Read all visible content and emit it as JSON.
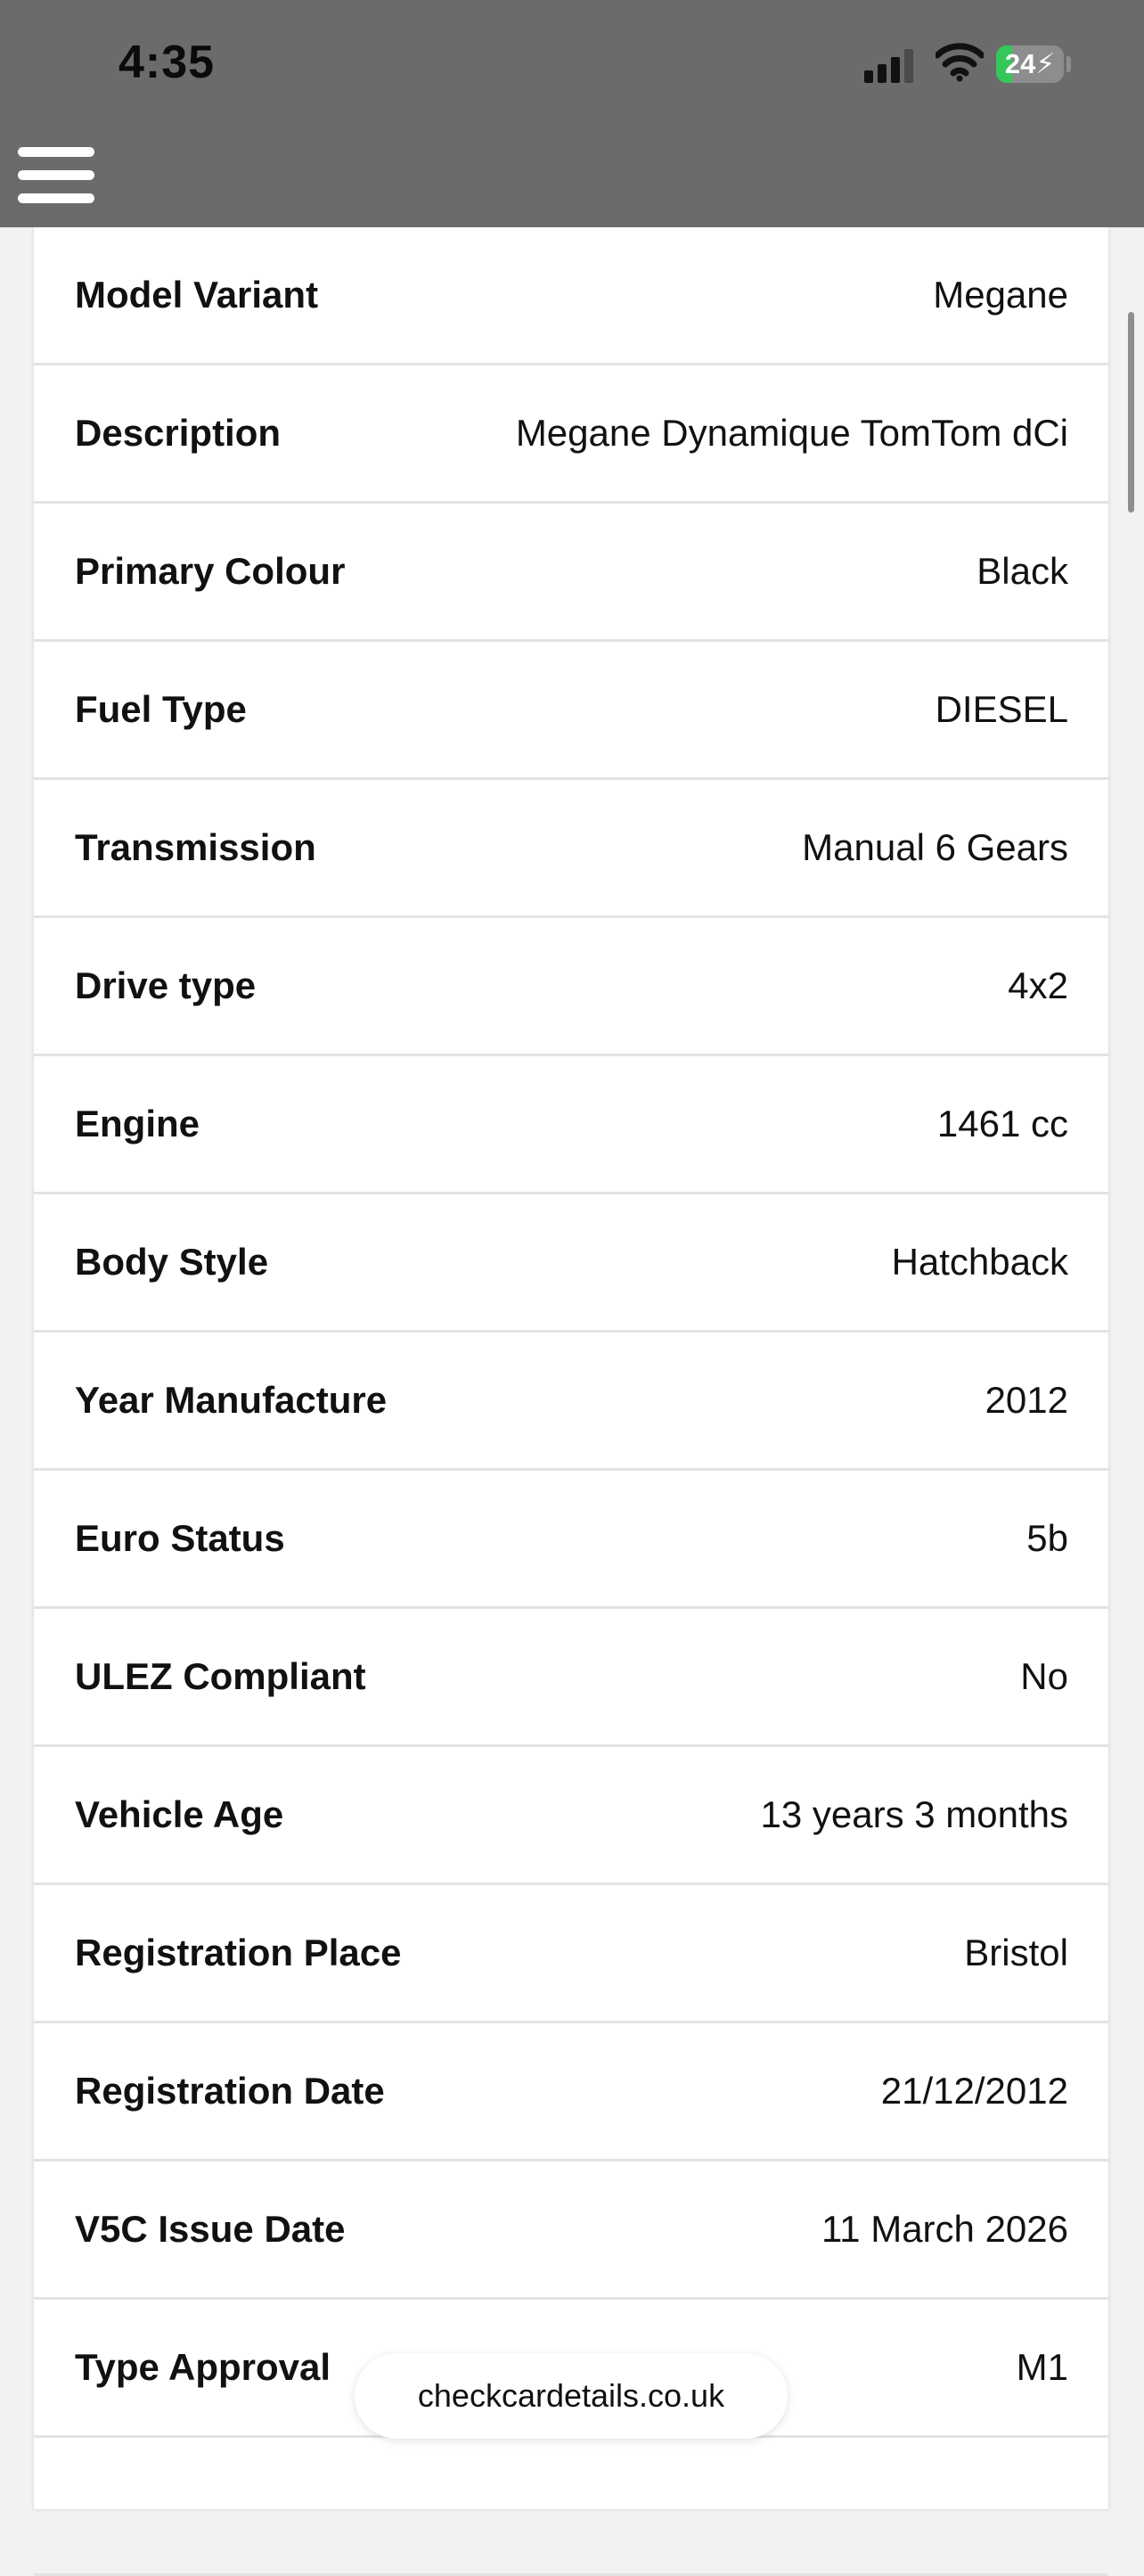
{
  "status_bar": {
    "time": "4:35",
    "battery_level": "24",
    "battery_fill_percent": 24,
    "battery_color": "#34c759",
    "icons": [
      "signal-icon",
      "wifi-icon",
      "battery-charging-icon"
    ]
  },
  "header": {
    "menu_icon": "hamburger-menu-icon",
    "background_color": "#6b6b6b"
  },
  "details": [
    {
      "label": "Model Variant",
      "value": "Megane"
    },
    {
      "label": "Description",
      "value": "Megane Dynamique TomTom dCi"
    },
    {
      "label": "Primary Colour",
      "value": "Black"
    },
    {
      "label": "Fuel Type",
      "value": "DIESEL"
    },
    {
      "label": "Transmission",
      "value": "Manual 6 Gears"
    },
    {
      "label": "Drive type",
      "value": "4x2"
    },
    {
      "label": "Engine",
      "value": "1461 cc"
    },
    {
      "label": "Body Style",
      "value": "Hatchback"
    },
    {
      "label": "Year Manufacture",
      "value": "2012"
    },
    {
      "label": "Euro Status",
      "value": "5b"
    },
    {
      "label": "ULEZ Compliant",
      "value": "No"
    },
    {
      "label": "Vehicle Age",
      "value": "13 years 3 months"
    },
    {
      "label": "Registration Place",
      "value": "Bristol"
    },
    {
      "label": "Registration Date",
      "value": "21/12/2012"
    },
    {
      "label": "V5C Issue Date",
      "value": "11 March 2026"
    },
    {
      "label": "Type Approval",
      "value": "M1"
    },
    {
      "label": "",
      "value": ""
    }
  ],
  "browser": {
    "domain": "checkcardetails.co.uk"
  }
}
